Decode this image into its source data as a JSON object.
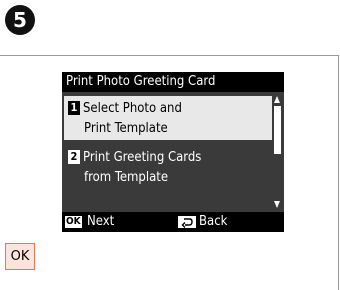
{
  "step": {
    "number": "5"
  },
  "screen": {
    "title": "Print Photo Greeting Card",
    "menu": [
      {
        "num": "1",
        "line1": "Select Photo and",
        "line2": "Print Template",
        "selected": true
      },
      {
        "num": "2",
        "line1": "Print Greeting Cards",
        "line2": "from Template",
        "selected": false
      }
    ],
    "footer": {
      "ok_key": "OK",
      "next_label": "Next",
      "back_icon": "back-arrow-icon",
      "back_label": "Back"
    }
  },
  "ok_button": {
    "label": "OK"
  },
  "colors": {
    "highlight": "#e8e8e8",
    "screen_bg": "#3a3a3a",
    "ok_bg": "#fce4dc",
    "ok_border": "#e07a5f"
  }
}
